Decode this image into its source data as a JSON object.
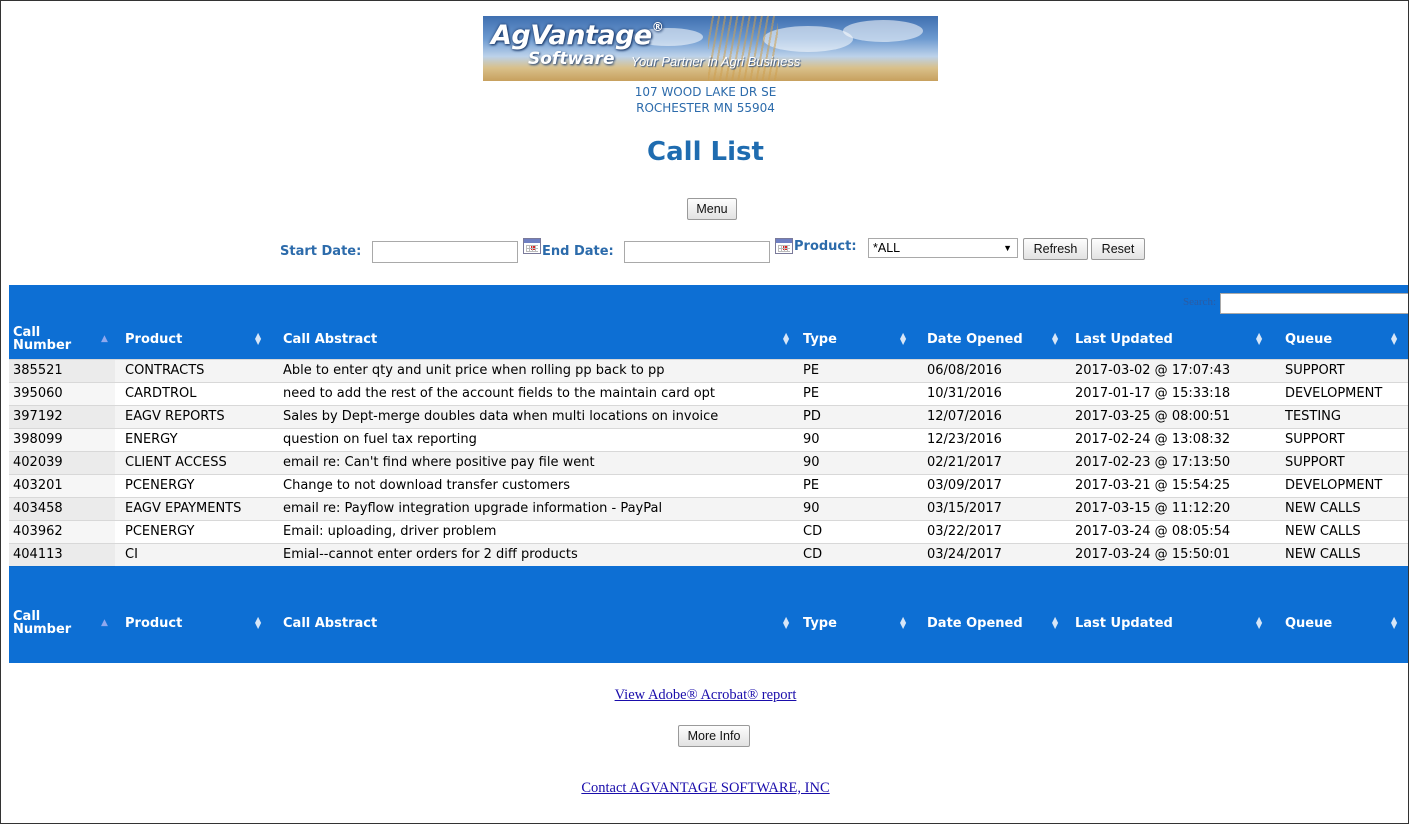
{
  "header": {
    "logo_brand": "AgVantage",
    "logo_registered": "®",
    "logo_software": "Software",
    "logo_tagline": "Your Partner in Agri Business",
    "address_line1": "107 WOOD LAKE DR SE",
    "address_line2": "ROCHESTER MN 55904",
    "page_title": "Call List"
  },
  "toolbar": {
    "menu_label": "Menu",
    "start_date_label": "Start Date:",
    "start_date_value": "",
    "end_date_label": "End Date:",
    "end_date_value": "",
    "product_label": "Product:",
    "product_selected": "*ALL",
    "refresh_label": "Refresh",
    "reset_label": "Reset"
  },
  "table": {
    "search_label": "Search:",
    "search_value": "",
    "columns": [
      {
        "key": "call_number",
        "line1": "Call",
        "line2": "Number"
      },
      {
        "key": "product",
        "label": "Product"
      },
      {
        "key": "abstract",
        "label": "Call Abstract"
      },
      {
        "key": "type",
        "label": "Type"
      },
      {
        "key": "opened",
        "label": "Date Opened"
      },
      {
        "key": "updated",
        "label": "Last Updated"
      },
      {
        "key": "queue",
        "label": "Queue"
      }
    ],
    "rows": [
      [
        "385521",
        "CONTRACTS",
        "Able to enter qty and unit price when rolling pp back to pp",
        "PE",
        "06/08/2016",
        "2017-03-02 @ 17:07:43",
        "SUPPORT"
      ],
      [
        "395060",
        "CARDTROL",
        "need to add the rest of the account fields to the maintain card opt",
        "PE",
        "10/31/2016",
        "2017-01-17 @ 15:33:18",
        "DEVELOPMENT"
      ],
      [
        "397192",
        "EAGV REPORTS",
        "Sales by Dept-merge doubles data when multi locations on invoice",
        "PD",
        "12/07/2016",
        "2017-03-25 @ 08:00:51",
        "TESTING"
      ],
      [
        "398099",
        "ENERGY",
        "question on fuel tax reporting",
        "90",
        "12/23/2016",
        "2017-02-24 @ 13:08:32",
        "SUPPORT"
      ],
      [
        "402039",
        "CLIENT ACCESS",
        "email re: Can't find where positive pay file went",
        "90",
        "02/21/2017",
        "2017-02-23 @ 17:13:50",
        "SUPPORT"
      ],
      [
        "403201",
        "PCENERGY",
        "Change to not download transfer customers",
        "PE",
        "03/09/2017",
        "2017-03-21 @ 15:54:25",
        "DEVELOPMENT"
      ],
      [
        "403458",
        "EAGV EPAYMENTS",
        "email re: Payflow integration upgrade information - PayPal",
        "90",
        "03/15/2017",
        "2017-03-15 @ 11:12:20",
        "NEW CALLS"
      ],
      [
        "403962",
        "PCENERGY",
        "Email: uploading, driver problem",
        "CD",
        "03/22/2017",
        "2017-03-24 @ 08:05:54",
        "NEW CALLS"
      ],
      [
        "404113",
        "CI",
        "Emial--cannot enter orders for 2 diff products",
        "CD",
        "03/24/2017",
        "2017-03-24 @ 15:50:01",
        "NEW CALLS"
      ]
    ]
  },
  "footer": {
    "acrobat_link": "View Adobe® Acrobat® report",
    "more_info_label": "More Info",
    "contact_link": "Contact AGVANTAGE SOFTWARE, INC"
  },
  "colors": {
    "header_blue": "#0d6fd4",
    "title_blue": "#1f6cb0",
    "link_color": "#1a0dab"
  }
}
